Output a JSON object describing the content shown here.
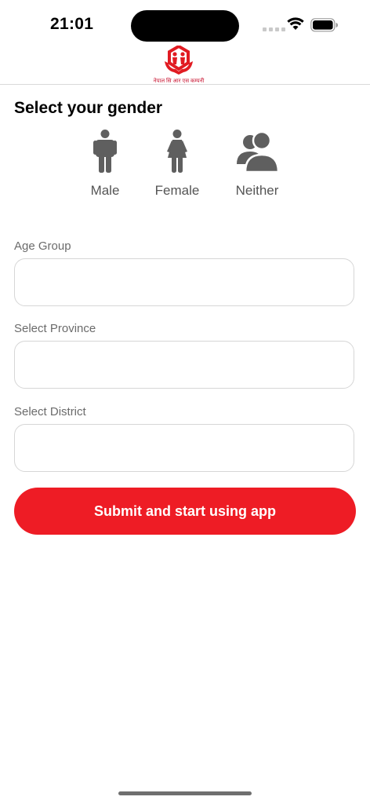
{
  "status_bar": {
    "time": "21:01",
    "icons": [
      "signal-dots-icon",
      "wifi-icon",
      "battery-icon"
    ]
  },
  "header": {
    "logo_caption": "नेपाल सि आर एस कम्पनी",
    "logo_color": "#e11b22"
  },
  "gender": {
    "title": "Select your gender",
    "options": [
      {
        "label": "Male",
        "icon": "male-icon"
      },
      {
        "label": "Female",
        "icon": "female-icon"
      },
      {
        "label": "Neither",
        "icon": "neither-icon"
      }
    ],
    "icon_color": "#5f5f5f"
  },
  "form": {
    "age_group_label": "Age Group",
    "age_group_value": "",
    "province_label": "Select Province",
    "province_value": "",
    "district_label": "Select District",
    "district_value": ""
  },
  "submit": {
    "label": "Submit and start using app",
    "color": "#ee1c25"
  }
}
